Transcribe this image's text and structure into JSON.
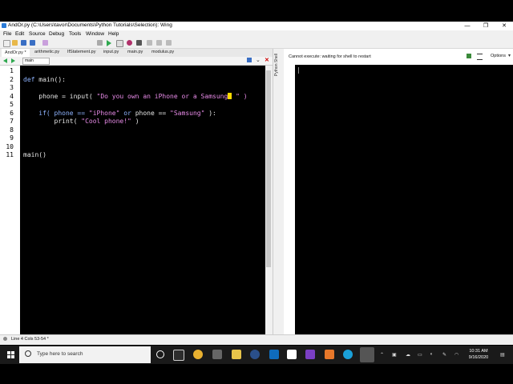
{
  "window": {
    "title": "AndOr.py (C:\\Users\\tavor\\Documents\\Python Tutorials\\Selection): Wing",
    "minimize": "—",
    "restore": "❐",
    "close": "✕"
  },
  "menu": [
    "File",
    "Edit",
    "Source",
    "Debug",
    "Tools",
    "Window",
    "Help"
  ],
  "tabs": [
    "AndOr.py *",
    "arithmetic.py",
    "IfStatement.py",
    "input.py",
    "main.py",
    "modulus.py"
  ],
  "nav": {
    "scope": "main"
  },
  "code_lines": [
    {
      "n": "1"
    },
    {
      "n": "2",
      "kw": "def",
      "rest": " main():"
    },
    {
      "n": "3"
    },
    {
      "n": "4",
      "pre": "    phone = input( ",
      "str": "\"Do you own an iPhone or a Samsung",
      "post": " \" )"
    },
    {
      "n": "5"
    },
    {
      "n": "6",
      "pre": "    if( phone == ",
      "s1": "\"iPhone\"",
      "mid": " or ",
      "mid2": "phone == ",
      "s2": "\"Samsung\"",
      "post": " ):"
    },
    {
      "n": "7",
      "pre": "        print( ",
      "str": "\"Cool phone!\"",
      "post": " )"
    },
    {
      "n": "8"
    },
    {
      "n": "9"
    },
    {
      "n": "10"
    },
    {
      "n": "11",
      "rest": "main()"
    }
  ],
  "shell": {
    "side_label": "Python Shell",
    "message": "Cannot execute: waiting for shell to restart",
    "options": "Options"
  },
  "status": {
    "text": "Line 4 Cols 53-54 *"
  },
  "taskbar": {
    "search_placeholder": "Type here to search",
    "time": "10:31 AM",
    "date": "9/16/2020"
  },
  "colors": {
    "keyword": "#8fb4ff",
    "string": "#e88be8",
    "cursor": "#ffd800"
  }
}
